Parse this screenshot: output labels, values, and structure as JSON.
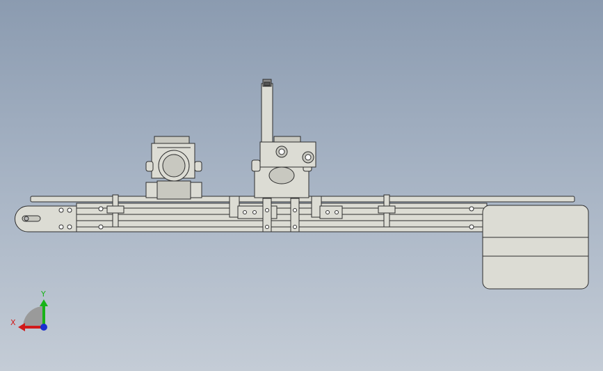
{
  "viewport": {
    "background_top": "#8b9bb0",
    "background_bottom": "#c4ccd6",
    "part_fill": "#dcdcd4",
    "part_fill_dark": "#c8c8c0",
    "edge_color": "#2d2d2d"
  },
  "triad": {
    "x_label": "X",
    "y_label": "Y",
    "x_color": "#d11a1a",
    "y_color": "#18b318",
    "z_color": "#1a2fd1"
  }
}
